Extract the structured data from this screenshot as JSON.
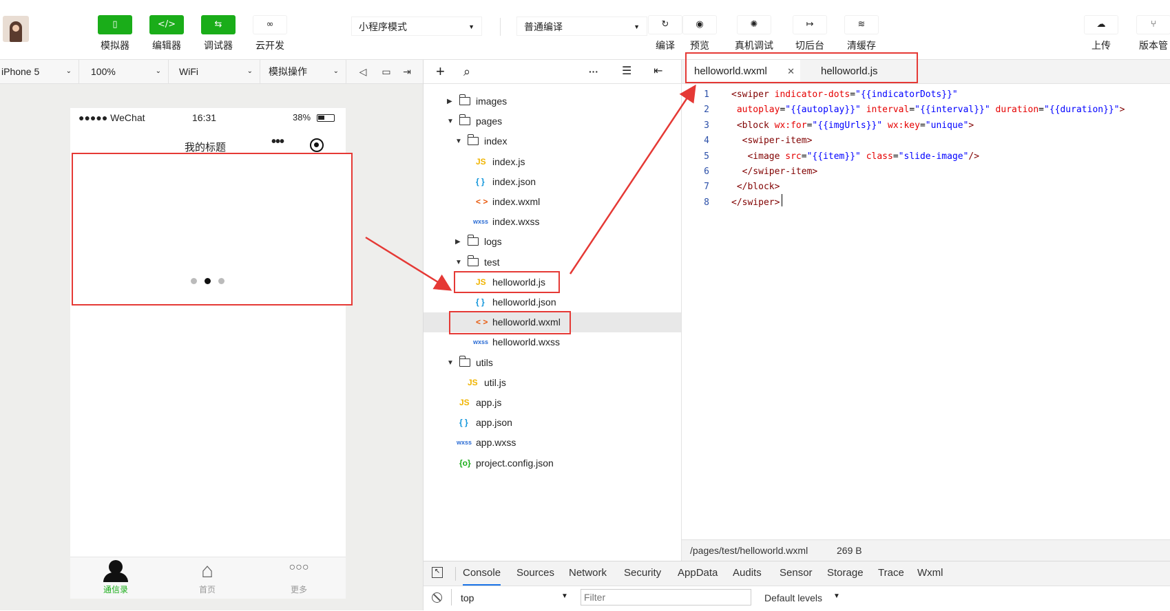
{
  "toolbar": {
    "buttons": [
      {
        "label": "模拟器",
        "icon": "phone-icon"
      },
      {
        "label": "编辑器",
        "icon": "code-icon"
      },
      {
        "label": "调试器",
        "icon": "debug-icon"
      },
      {
        "label": "云开发",
        "icon": "cloud-link-icon"
      }
    ],
    "mode_select": "小程序模式",
    "compile_select": "普通编译",
    "actions": [
      {
        "label": "编译",
        "icon": "refresh-icon"
      },
      {
        "label": "预览",
        "icon": "eye-icon"
      },
      {
        "label": "真机调试",
        "icon": "bug-icon"
      },
      {
        "label": "切后台",
        "icon": "switch-icon"
      },
      {
        "label": "清缓存",
        "icon": "layers-icon"
      },
      {
        "label": "上传",
        "icon": "upload-icon"
      },
      {
        "label": "版本管",
        "icon": "branch-icon"
      }
    ],
    "glyphs": {
      "phone": "▯",
      "code": "</>",
      "debug": "⇆",
      "cloud": "∞",
      "refresh": "↻",
      "eye": "◉",
      "bug": "✺",
      "switch": "↦",
      "layers": "≋",
      "upload": "☁",
      "branch": "⑂"
    }
  },
  "sim_bar": {
    "device": "iPhone 5",
    "zoom": "100%",
    "network": "WiFi",
    "operation": "模拟操作"
  },
  "phone": {
    "signal": "●●●●● WeChat",
    "time": "16:31",
    "battery": "38%",
    "nav_title": "我的标题",
    "nav_more": "•••",
    "swiper_active_dot": 1,
    "tabs": [
      {
        "label": "通信录",
        "icon": "contacts-icon",
        "active": true
      },
      {
        "label": "首页",
        "icon": "home-icon",
        "active": false
      },
      {
        "label": "更多",
        "icon": "more-icon",
        "active": false
      }
    ]
  },
  "tree": {
    "items": [
      {
        "name": "images",
        "type": "folder",
        "depth": 0,
        "open": false
      },
      {
        "name": "pages",
        "type": "folder",
        "depth": 0,
        "open": true
      },
      {
        "name": "index",
        "type": "folder",
        "depth": 1,
        "open": true
      },
      {
        "name": "index.js",
        "type": "js",
        "depth": 2
      },
      {
        "name": "index.json",
        "type": "json",
        "depth": 2
      },
      {
        "name": "index.wxml",
        "type": "wxml",
        "depth": 2
      },
      {
        "name": "index.wxss",
        "type": "wxss",
        "depth": 2
      },
      {
        "name": "logs",
        "type": "folder",
        "depth": 1,
        "open": false
      },
      {
        "name": "test",
        "type": "folder",
        "depth": 1,
        "open": true
      },
      {
        "name": "helloworld.js",
        "type": "js",
        "depth": 2
      },
      {
        "name": "helloworld.json",
        "type": "json",
        "depth": 2
      },
      {
        "name": "helloworld.wxml",
        "type": "wxml",
        "depth": 2,
        "selected": true
      },
      {
        "name": "helloworld.wxss",
        "type": "wxss",
        "depth": 2
      },
      {
        "name": "utils",
        "type": "folder",
        "depth": 0,
        "open": true
      },
      {
        "name": "util.js",
        "type": "js",
        "depth": 1
      },
      {
        "name": "app.js",
        "type": "js",
        "depth": 0
      },
      {
        "name": "app.json",
        "type": "json",
        "depth": 0
      },
      {
        "name": "app.wxss",
        "type": "wxss",
        "depth": 0
      },
      {
        "name": "project.config.json",
        "type": "config",
        "depth": 0
      }
    ],
    "icon_text": {
      "js": "JS",
      "json": "{ }",
      "wxml": "< >",
      "wxss": "wxss",
      "config": "{o}"
    },
    "icon_color": {
      "js": "#f0b400",
      "json": "#1296db",
      "wxml": "#e8590c",
      "wxss": "#2b6cd4",
      "config": "#1aad19"
    }
  },
  "editor": {
    "tabs": [
      {
        "label": "helloworld.wxml",
        "close": "✕",
        "active": true
      },
      {
        "label": "helloworld.js",
        "active": false
      }
    ],
    "lines": [
      [
        [
          "t",
          "<swiper "
        ],
        [
          "a",
          "indicator-dots"
        ],
        [
          "p",
          "="
        ],
        [
          "s",
          "\"{{indicatorDots}}\""
        ]
      ],
      [
        [
          "p",
          " "
        ],
        [
          "a",
          "autoplay"
        ],
        [
          "p",
          "="
        ],
        [
          "s",
          "\"{{autoplay}}\""
        ],
        [
          "p",
          " "
        ],
        [
          "a",
          "interval"
        ],
        [
          "p",
          "="
        ],
        [
          "s",
          "\"{{interval}}\""
        ],
        [
          "p",
          " "
        ],
        [
          "a",
          "duration"
        ],
        [
          "p",
          "="
        ],
        [
          "s",
          "\"{{duration}}\""
        ],
        [
          "t",
          ">"
        ]
      ],
      [
        [
          "p",
          " "
        ],
        [
          "t",
          "<block "
        ],
        [
          "a",
          "wx:for"
        ],
        [
          "p",
          "="
        ],
        [
          "s",
          "\"{{imgUrls}}\""
        ],
        [
          "p",
          " "
        ],
        [
          "a",
          "wx:key"
        ],
        [
          "p",
          "="
        ],
        [
          "s",
          "\"unique\""
        ],
        [
          "t",
          ">"
        ]
      ],
      [
        [
          "p",
          "  "
        ],
        [
          "t",
          "<swiper-item>"
        ]
      ],
      [
        [
          "p",
          "   "
        ],
        [
          "t",
          "<image "
        ],
        [
          "a",
          "src"
        ],
        [
          "p",
          "="
        ],
        [
          "s",
          "\"{{item}}\""
        ],
        [
          "p",
          " "
        ],
        [
          "a",
          "class"
        ],
        [
          "p",
          "="
        ],
        [
          "s",
          "\"slide-image\""
        ],
        [
          "t",
          "/>"
        ]
      ],
      [
        [
          "p",
          "  "
        ],
        [
          "t",
          "</swiper-item>"
        ]
      ],
      [
        [
          "p",
          " "
        ],
        [
          "t",
          "</block>"
        ]
      ],
      [
        [
          "t",
          "</swiper>"
        ]
      ]
    ],
    "path": "/pages/test/helloworld.wxml",
    "size": "269 B"
  },
  "devtools": {
    "tabs": [
      "Console",
      "Sources",
      "Network",
      "Security",
      "AppData",
      "Audits",
      "Sensor",
      "Storage",
      "Trace",
      "Wxml"
    ],
    "context": "top",
    "filter_placeholder": "Filter",
    "levels": "Default levels"
  },
  "colors": {
    "brand_green": "#1aad19",
    "annotation_red": "#e53935",
    "tab_active": "#1a73e8"
  }
}
